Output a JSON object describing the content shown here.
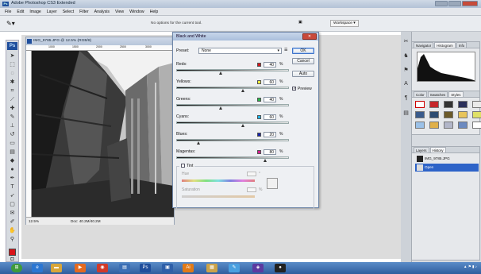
{
  "app": {
    "title": "Adobe Photoshop CS3 Extended"
  },
  "menu": [
    "File",
    "Edit",
    "Image",
    "Layer",
    "Select",
    "Filter",
    "Analysis",
    "View",
    "Window",
    "Help"
  ],
  "options": {
    "hint": "No options for the current tool.",
    "workspace": "Workspace"
  },
  "document": {
    "title": "IMG_9785.JPG @ 12.5% (RGB/8)",
    "ruler_marks": [
      "1000",
      "1500",
      "2000",
      "2500",
      "3000"
    ],
    "zoom": "12.5%",
    "doc_size": "Doc: 40.2M/40.2M"
  },
  "bw_dialog": {
    "title": "Black and White",
    "preset_label": "Preset:",
    "preset_value": "None",
    "ok": "OK",
    "cancel": "Cancel",
    "auto": "Auto",
    "preview": "Preview",
    "preview_checked": "✓",
    "pct": "%",
    "sliders": [
      {
        "name": "Reds:",
        "value": "40",
        "color": "#d0161c",
        "level": 0.4
      },
      {
        "name": "Yellows:",
        "value": "60",
        "color": "#f2ee3b",
        "level": 0.6
      },
      {
        "name": "Greens:",
        "value": "40",
        "color": "#29b649",
        "level": 0.4
      },
      {
        "name": "Cyans:",
        "value": "60",
        "color": "#1fb4e6",
        "level": 0.6
      },
      {
        "name": "Blues:",
        "value": "20",
        "color": "#1522a8",
        "level": 0.2
      },
      {
        "name": "Magentas:",
        "value": "80",
        "color": "#d61f8f",
        "level": 0.8
      }
    ],
    "tint": {
      "label": "Tint",
      "hue": "Hue",
      "saturation": "Saturation",
      "hue_unit": "°",
      "sat_unit": "%"
    }
  },
  "panels": {
    "navigator_tabs": [
      "Navigator",
      "Histogram",
      "Info"
    ],
    "color_tabs": [
      "Color",
      "Swatches",
      "Styles"
    ],
    "layers_tabs": [
      "Layers",
      "History"
    ],
    "history": [
      {
        "label": "IMG_9785.JPG"
      },
      {
        "label": "Open"
      }
    ]
  },
  "colors": {
    "accent": "#2d63c8",
    "foreground": "#d8141b"
  }
}
